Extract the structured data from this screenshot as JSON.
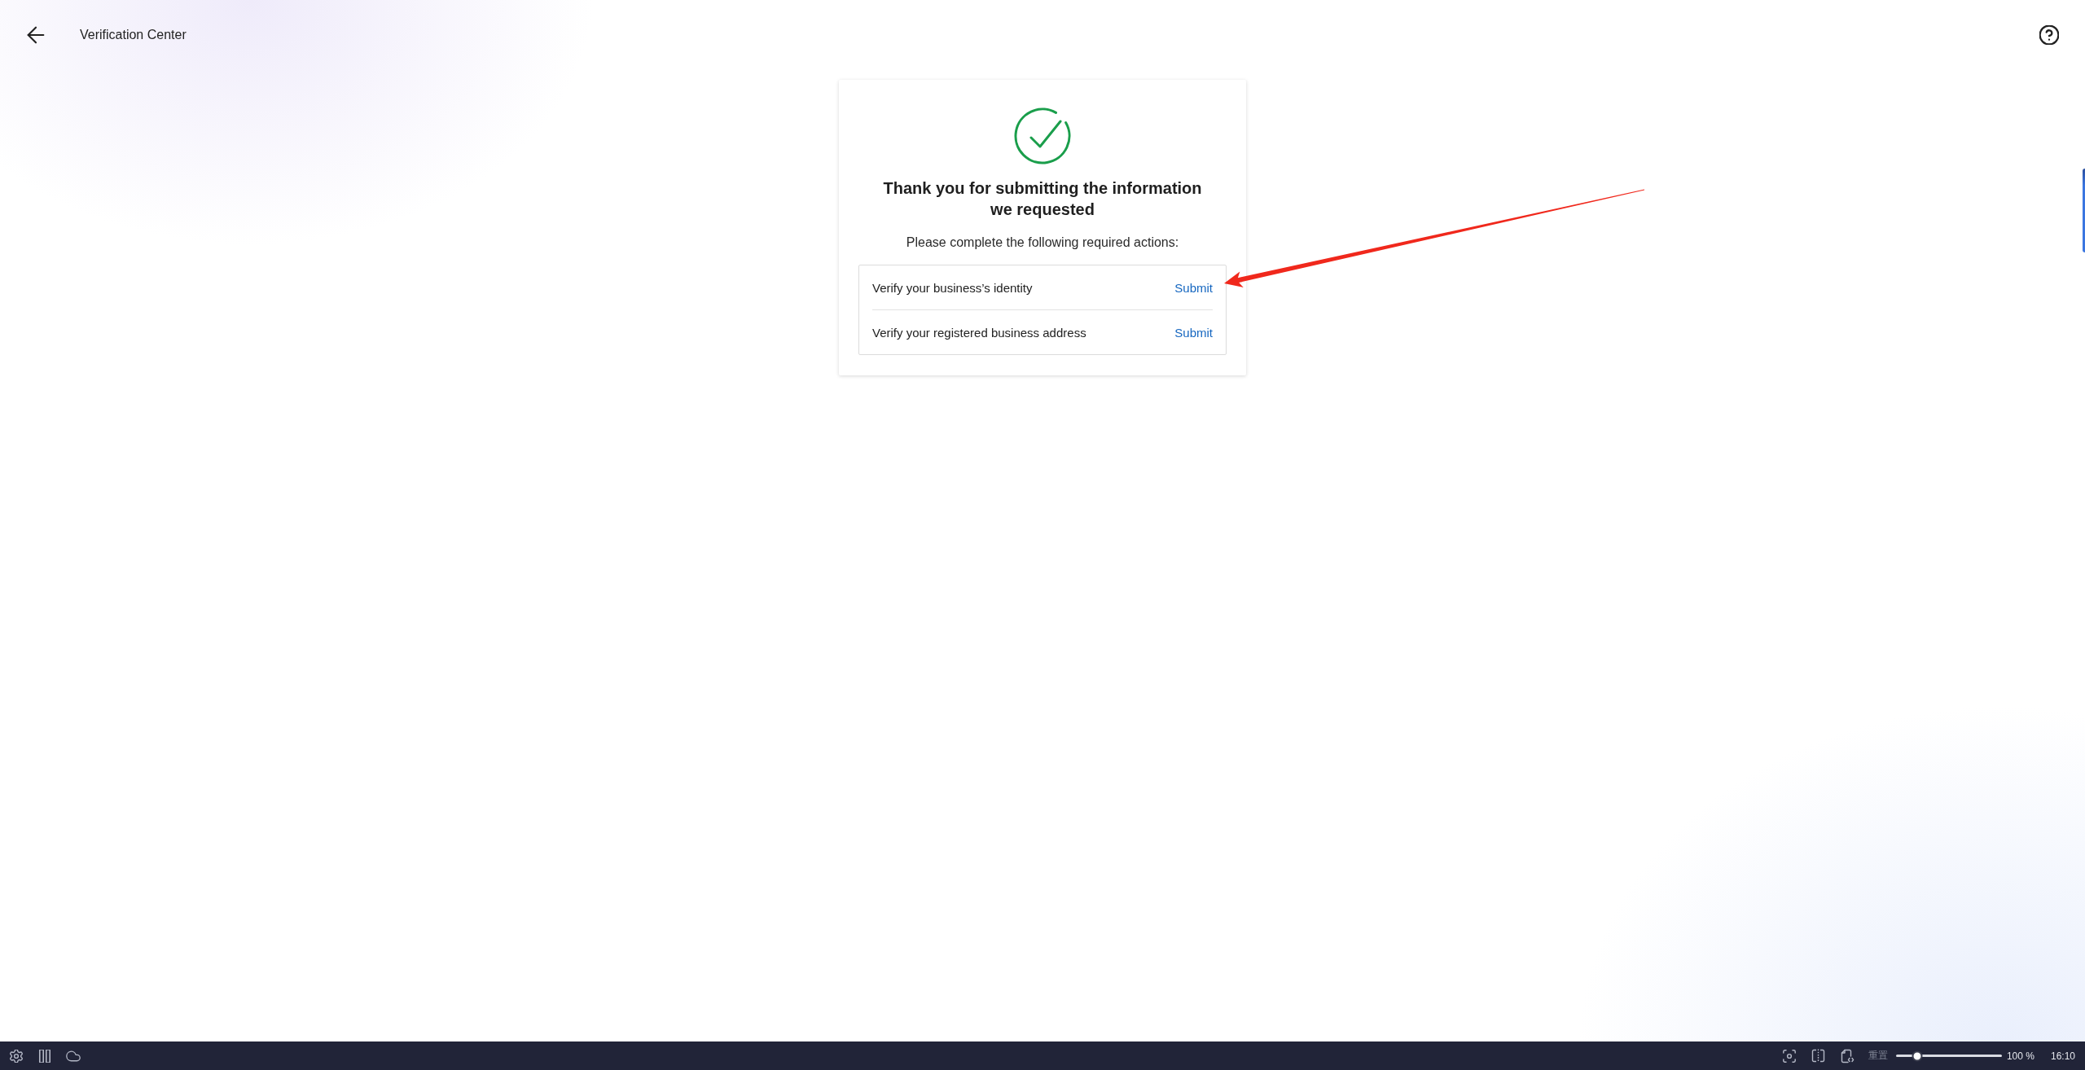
{
  "header": {
    "title": "Verification Center"
  },
  "card": {
    "title": "Thank you for submitting the information we requested",
    "subtitle": "Please complete the following required actions:",
    "actions": [
      {
        "label": "Verify your business’s identity",
        "link": "Submit"
      },
      {
        "label": "Verify your registered business address",
        "link": "Submit"
      }
    ]
  },
  "taskbar": {
    "reset": "重置",
    "zoom": {
      "level": 0.2,
      "reading": "100 %"
    },
    "time": "16:10"
  }
}
